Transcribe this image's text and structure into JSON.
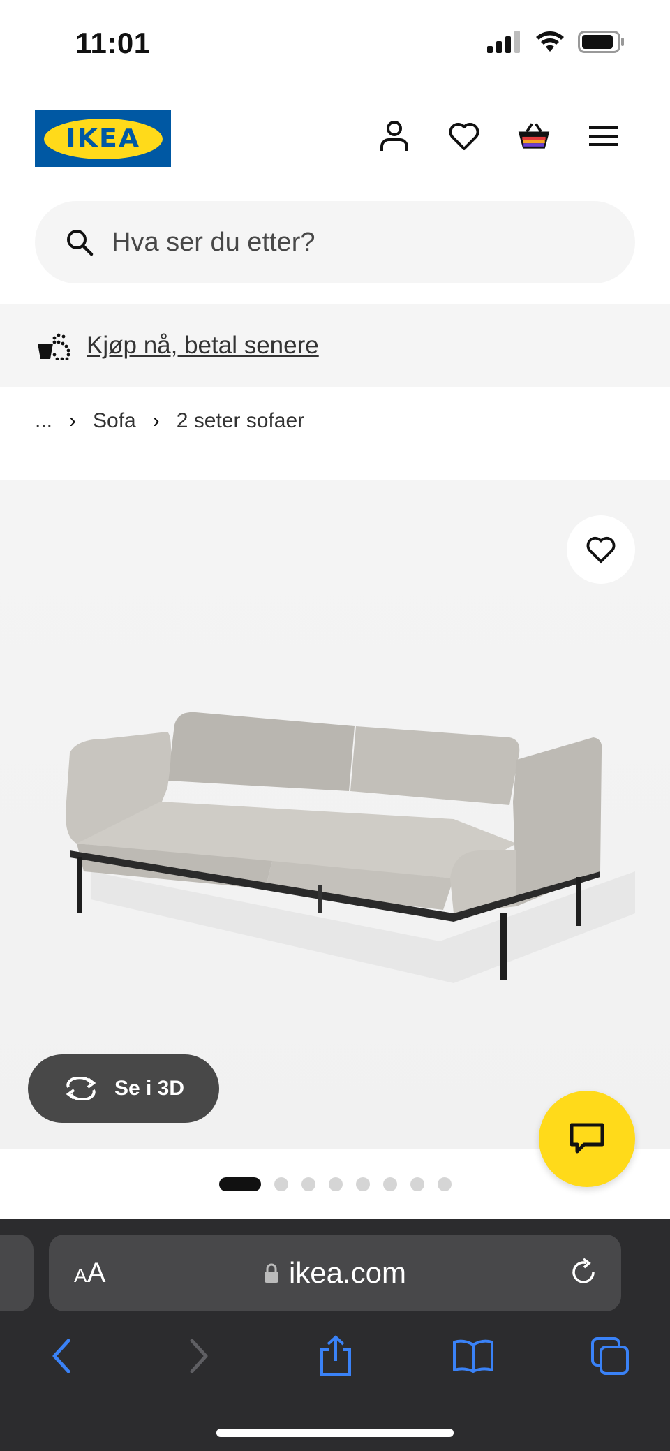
{
  "status": {
    "time": "11:01"
  },
  "header": {
    "logo_text": "IKEA"
  },
  "search": {
    "placeholder": "Hva ser du etter?"
  },
  "banner": {
    "link_text": "Kjøp nå, betal senere"
  },
  "breadcrumb": {
    "items": [
      "...",
      "Sofa",
      "2 seter sofaer"
    ]
  },
  "product": {
    "view_3d_label": "Se i 3D"
  },
  "gallery": {
    "total_images": 8,
    "active_index": 0
  },
  "browser": {
    "aa_small": "A",
    "aa_large": "A",
    "url": "ikea.com"
  },
  "colors": {
    "ikea_blue": "#0058a3",
    "ikea_yellow": "#ffda1a",
    "safari_bg": "#2c2c2e",
    "safari_blue": "#3a82f7"
  },
  "icons": [
    "signal-icon",
    "wifi-icon",
    "battery-icon",
    "profile-icon",
    "heart-icon",
    "basket-icon",
    "menu-icon",
    "search-icon",
    "installment-icon",
    "chevron-right-icon",
    "rotate-3d-icon",
    "chat-icon",
    "lock-icon",
    "reload-icon",
    "back-icon",
    "forward-icon",
    "share-icon",
    "bookmarks-icon",
    "tabs-icon"
  ]
}
